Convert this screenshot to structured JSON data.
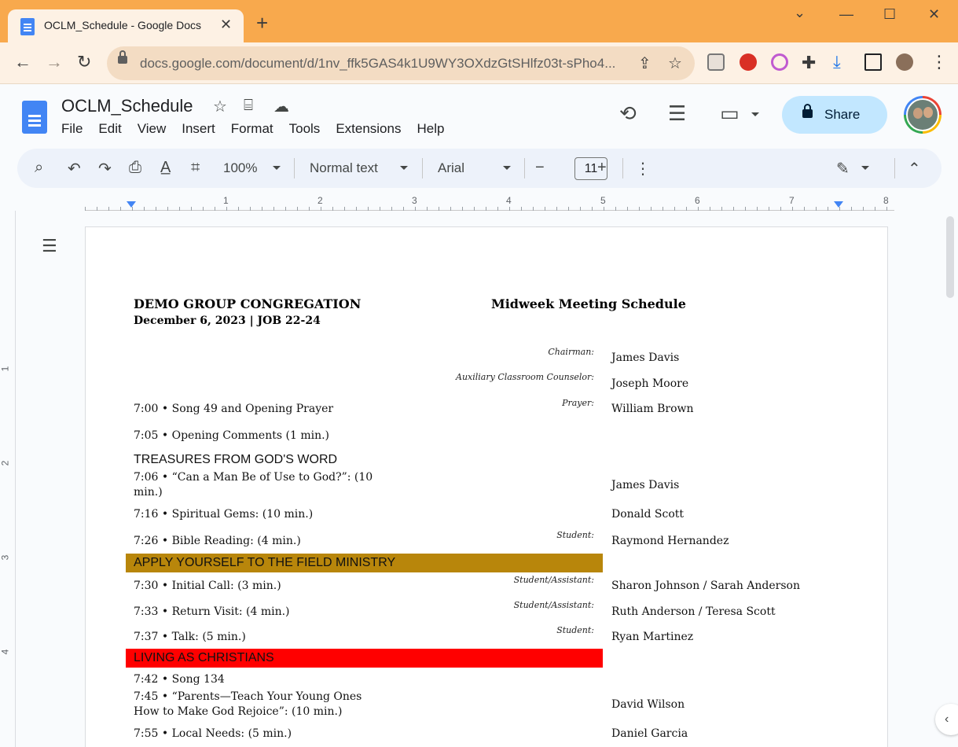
{
  "browser": {
    "tab_title": "OCLM_Schedule - Google Docs",
    "url": "docs.google.com/document/d/1nv_ffk5GAS4k1U9WY3OXdzGtSHlfz03t-sPho4...",
    "controls": {
      "close_tab": "✕",
      "new_tab": "+",
      "minimize": "—",
      "maximize": "☐",
      "close_window": "✕",
      "chevron": "⌄"
    }
  },
  "docs": {
    "title": "OCLM_Schedule",
    "menu": [
      "File",
      "Edit",
      "View",
      "Insert",
      "Format",
      "Tools",
      "Extensions",
      "Help"
    ],
    "share_label": "Share",
    "toolbar": {
      "zoom": "100%",
      "style": "Normal text",
      "font": "Arial",
      "font_size": "11",
      "minus": "−",
      "plus": "+"
    },
    "ruler_numbers": [
      "1",
      "2",
      "3",
      "4",
      "5",
      "6",
      "7",
      "8"
    ],
    "vruler_numbers": [
      "1",
      "2",
      "3",
      "4"
    ]
  },
  "document": {
    "congregation": "DEMO GROUP CONGREGATION",
    "date_line": "December 6, 2023 | JOB 22-24",
    "schedule_title": "Midweek Meeting Schedule",
    "roles": {
      "chairman": "Chairman:",
      "aux_counselor": "Auxiliary Classroom Counselor:",
      "prayer": "Prayer:",
      "student": "Student:",
      "student_assistant": "Student/Assistant:"
    },
    "names": {
      "chairman": "James Davis",
      "aux_counselor": "Joseph Moore",
      "prayer": "William Brown",
      "treasures_talk": "James Davis",
      "gems": "Donald Scott",
      "bible_reading": "Raymond Hernandez",
      "initial_call": "Sharon Johnson / Sarah Anderson",
      "return_visit": "Ruth Anderson / Teresa Scott",
      "talk": "Ryan Martinez",
      "parents_part": "David Wilson",
      "local_needs": "Daniel Garcia"
    },
    "items": {
      "song_open": "7:00 • Song 49 and Opening Prayer",
      "opening_comments": "7:05 • Opening Comments (1 min.)",
      "treasures_header": "TREASURES FROM GOD'S WORD",
      "treasures_talk_1": "7:06 • “Can a Man Be of Use to God?”: (10",
      "treasures_talk_2": "min.)",
      "gems": "7:16 • Spiritual Gems: (10 min.)",
      "bible_reading": "7:26 • Bible Reading: (4 min.)",
      "field_header": "APPLY YOURSELF TO THE FIELD MINISTRY",
      "initial_call": "7:30 • Initial Call: (3 min.)",
      "return_visit": "7:33 • Return Visit: (4 min.)",
      "talk": "7:37 • Talk: (5 min.)",
      "christians_header": "LIVING AS CHRISTIANS",
      "song_mid": "7:42 • Song 134",
      "parents_1": "7:45 • “Parents—Teach Your Young Ones",
      "parents_2": "How to Make God Rejoice”: (10 min.)",
      "local_needs": "7:55 • Local Needs: (5 min.)"
    },
    "colors": {
      "field_band": "#b8860b",
      "christians_band": "#ff0000"
    }
  }
}
